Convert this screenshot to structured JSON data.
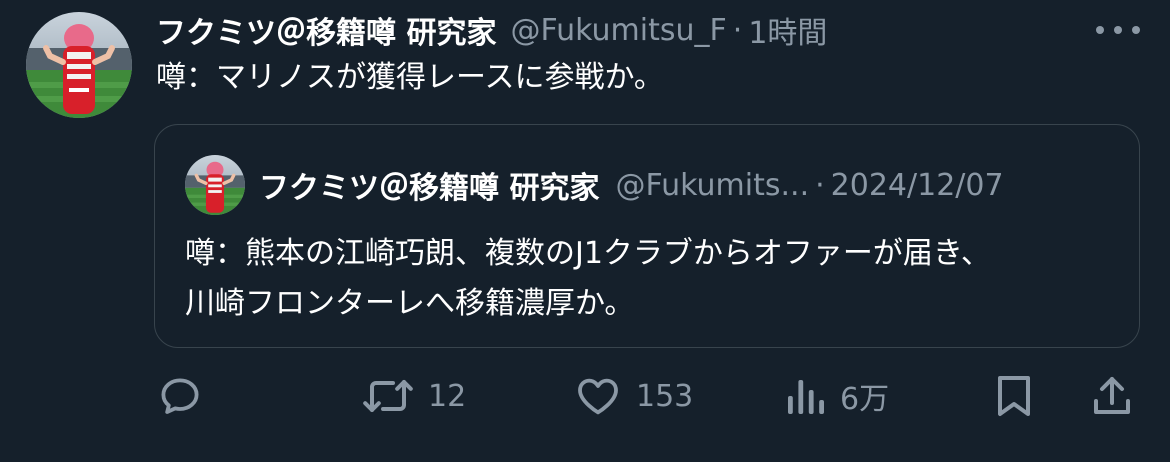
{
  "tweet": {
    "author_name": "フクミツ＠移籍噂 研究家",
    "handle": "@Fukumitsu_F",
    "separator": "·",
    "time": "1時間",
    "text": "噂：マリノスが獲得レースに参戦か。"
  },
  "quoted_tweet": {
    "author_name": "フクミツ＠移籍噂 研究家",
    "handle": "@Fukumits...",
    "separator": "·",
    "date": "2024/12/07",
    "text_lines": [
      "噂：熊本の江崎巧朗、複数のJ1クラブからオファーが届き、",
      "川崎フロンターレへ移籍濃厚か。"
    ]
  },
  "actions": {
    "reply_count": "",
    "retweet_count": "12",
    "like_count": "153",
    "views_count": "6万"
  },
  "icons": {
    "more": "more-icon",
    "reply": "reply-icon",
    "retweet": "retweet-icon",
    "like": "heart-icon",
    "views": "views-icon",
    "bookmark": "bookmark-icon",
    "share": "share-icon"
  },
  "colors": {
    "background": "#15202b",
    "text_primary": "#ffffff",
    "text_secondary": "#8b98a5",
    "border": "#38444d"
  }
}
